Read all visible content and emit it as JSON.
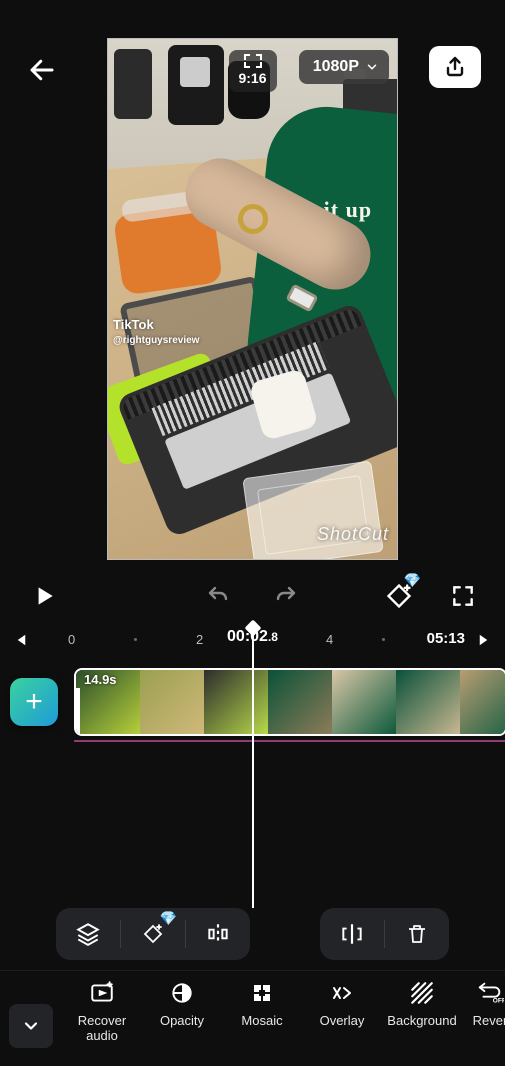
{
  "header": {
    "aspect_label": "9:16",
    "resolution": "1080P"
  },
  "preview": {
    "tiktok_brand": "TikTok",
    "tiktok_handle": "@rightguysreview",
    "apron_text": "ok it up",
    "watermark": "ShotCut"
  },
  "ruler": {
    "marks": [
      "0",
      "2",
      "4"
    ],
    "current_time_main": "00:02",
    "current_time_frac": ".8",
    "total_time": "05:13"
  },
  "clip": {
    "duration_label": "14.9s"
  },
  "mini_toolbar": {
    "layers": "layers-icon",
    "keyframe": "keyframe-icon",
    "split": "split-icon",
    "split_all": "split-all-icon",
    "delete": "trash-icon"
  },
  "tools": [
    {
      "id": "recover-audio",
      "label": "Recover audio"
    },
    {
      "id": "opacity",
      "label": "Opacity"
    },
    {
      "id": "mosaic",
      "label": "Mosaic"
    },
    {
      "id": "overlay",
      "label": "Overlay"
    },
    {
      "id": "background",
      "label": "Background"
    },
    {
      "id": "reverse",
      "label": "Rever"
    }
  ],
  "icons": {
    "back": "←",
    "play": "▶",
    "add": "+",
    "chev_down": "▾",
    "drag_left": "‹"
  }
}
